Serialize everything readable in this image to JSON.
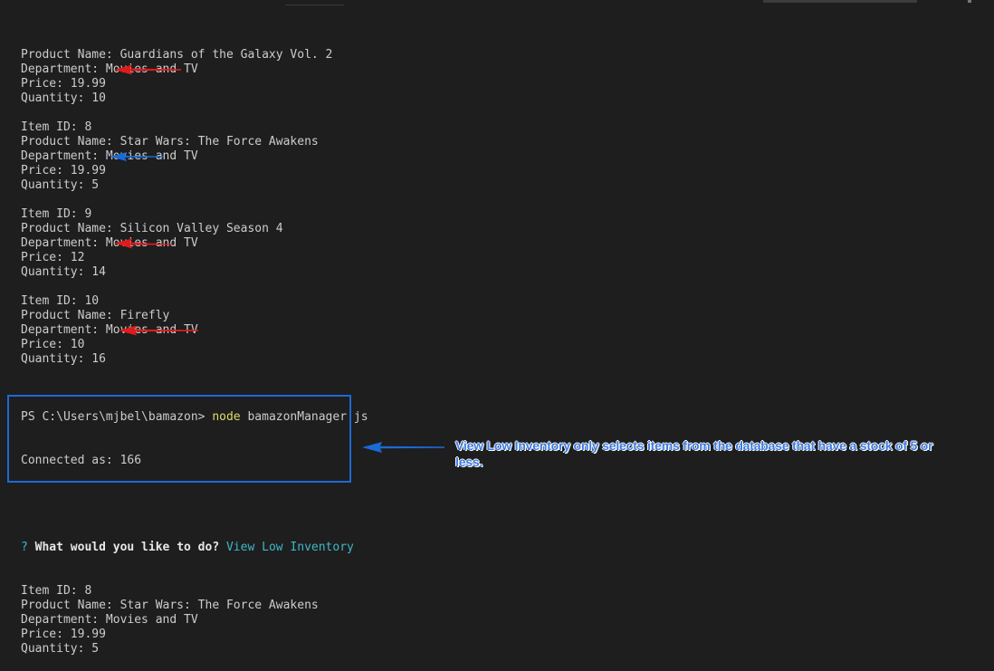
{
  "colors": {
    "background": "#1e1e1e",
    "text": "#cccccc",
    "command_keyword": "#dcdc6b",
    "prompt_accent": "#3fb7c8",
    "red_arrow": "#e01b1b",
    "blue_arrow": "#1b6ad6",
    "annotation_text": "#3b7be0"
  },
  "terminal": {
    "lines_top": [
      "Product Name: Guardians of the Galaxy Vol. 2",
      "Department: Movies and TV",
      "Price: 19.99",
      "Quantity: 10",
      "",
      "Item ID: 8",
      "Product Name: Star Wars: The Force Awakens",
      "Department: Movies and TV",
      "Price: 19.99",
      "Quantity: 5",
      "",
      "Item ID: 9",
      "Product Name: Silicon Valley Season 4",
      "Department: Movies and TV",
      "Price: 12",
      "Quantity: 14",
      "",
      "Item ID: 10",
      "Product Name: Firefly",
      "Department: Movies and TV",
      "Price: 10",
      "Quantity: 16",
      ""
    ],
    "command": {
      "prompt": "PS C:\\Users\\mjbel\\bamazon> ",
      "keyword": "node",
      "args": " bamazonManager.js"
    },
    "connected": "Connected as: 166",
    "question": {
      "mark": "?",
      "text": "What would you like to do?",
      "answer": "View Low Inventory"
    },
    "result_lines": [
      "Item ID: 8",
      "Product Name: Star Wars: The Force Awakens",
      "Department: Movies and TV",
      "Price: 19.99",
      "Quantity: 5"
    ]
  },
  "annotation": {
    "text": "View Low Inventory only selects items from the database that have a stock of 5 or less."
  },
  "arrows": [
    {
      "name": "quantity-10-arrow",
      "color": "red"
    },
    {
      "name": "quantity-5-arrow",
      "color": "blue"
    },
    {
      "name": "quantity-14-arrow",
      "color": "red"
    },
    {
      "name": "quantity-16-arrow",
      "color": "red"
    },
    {
      "name": "annotation-arrow",
      "color": "blue"
    }
  ]
}
